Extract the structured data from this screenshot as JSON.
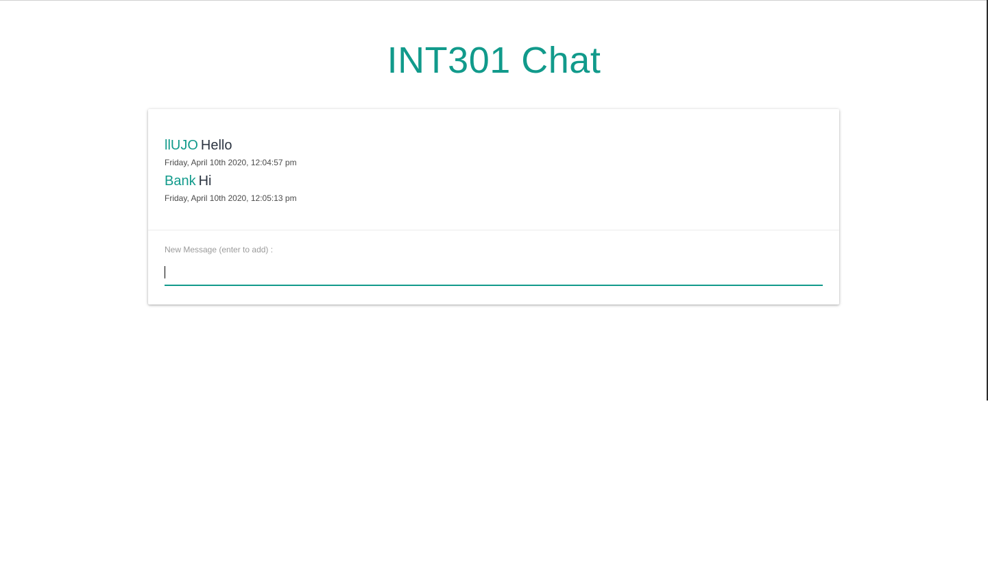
{
  "page": {
    "title": "INT301 Chat"
  },
  "messages": [
    {
      "user": "llUJO",
      "text": "Hello",
      "timestamp": "Friday, April 10th 2020, 12:04:57 pm"
    },
    {
      "user": "Bank",
      "text": "Hi",
      "timestamp": "Friday, April 10th 2020, 12:05:13 pm"
    }
  ],
  "composer": {
    "label": "New Message (enter to add) :",
    "value": ""
  },
  "colors": {
    "accent": "#119a8b",
    "message_text": "#2c3441",
    "timestamp": "#4a4a4a",
    "label": "#9a9a9a"
  }
}
